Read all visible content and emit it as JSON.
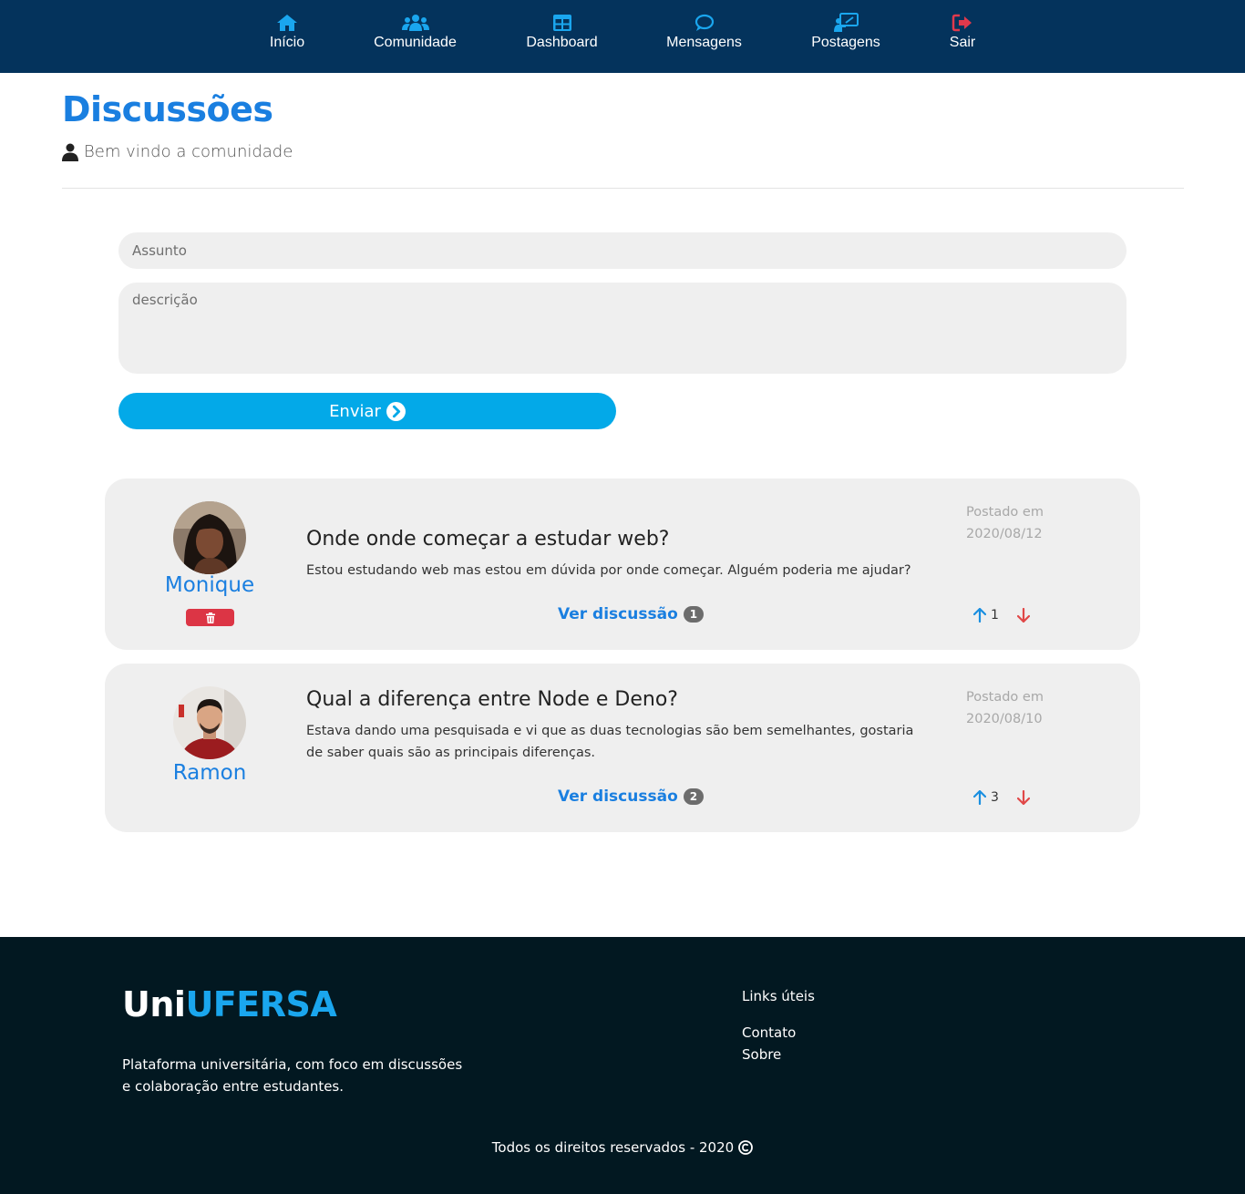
{
  "nav": {
    "items": [
      {
        "label": "Início",
        "icon": "home-icon"
      },
      {
        "label": "Comunidade",
        "icon": "users-icon"
      },
      {
        "label": "Dashboard",
        "icon": "table-icon"
      },
      {
        "label": "Mensagens",
        "icon": "chat-icon"
      },
      {
        "label": "Postagens",
        "icon": "presentation-icon"
      },
      {
        "label": "Sair",
        "icon": "logout-icon"
      }
    ]
  },
  "header": {
    "title": "Discussões",
    "subtitle": "Bem vindo a comunidade"
  },
  "form": {
    "subject_placeholder": "Assunto",
    "description_placeholder": "descrição",
    "submit_label": "Enviar"
  },
  "posts": [
    {
      "author": "Monique",
      "title": "Onde onde começar a estudar web?",
      "body": "Estou estudando web mas estou em dúvida por onde começar. Alguém poderia me ajudar?",
      "date_label": "Postado em",
      "date": "2020/08/12",
      "link_label": "Ver discussão",
      "replies": "1",
      "votes": "1",
      "deletable": true
    },
    {
      "author": "Ramon",
      "title": "Qual a diferença entre Node e Deno?",
      "body": "Estava dando uma pesquisada e vi que as duas tecnologias são bem semelhantes, gostaria de saber quais são as principais diferenças.",
      "date_label": "Postado em",
      "date": "2020/08/10",
      "link_label": "Ver discussão",
      "replies": "2",
      "votes": "3",
      "deletable": false
    }
  ],
  "footer": {
    "brand_first": "Uni",
    "brand_second": "UFERSA",
    "description": "Plataforma universitária, com foco em discussões e colaboração entre estudantes.",
    "links_title": "Links úteis",
    "links": [
      "Contato",
      "Sobre"
    ],
    "copyright": "Todos os direitos reservados - 2020"
  },
  "colors": {
    "nav_bg": "#04335c",
    "accent": "#1a7fe0",
    "nav_icon": "#1aa6ee",
    "logout_icon": "#e0394c",
    "send_button": "#03a9e8",
    "delete_button": "#dc3545",
    "upvote": "#1a8fe0",
    "downvote": "#e04848",
    "footer_bg": "#021821"
  }
}
